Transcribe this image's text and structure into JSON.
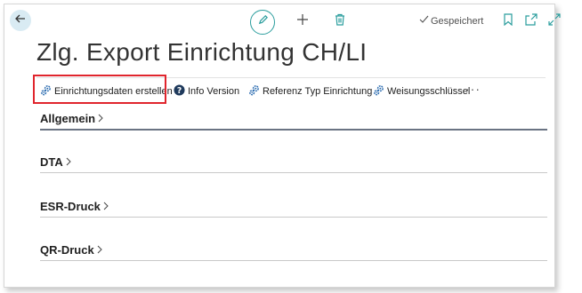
{
  "header": {
    "saved_status": "Gespeichert",
    "icons": {
      "back": "arrow-left-icon",
      "edit": "pencil-icon",
      "new": "plus-icon",
      "delete": "trash-icon",
      "saved": "checkmark-icon",
      "bookmark": "bookmark-icon",
      "open_new_window": "open-in-new-window-icon",
      "expand": "expand-diagonal-icon"
    }
  },
  "page": {
    "title": "Zlg. Export Einrichtung CH/LI"
  },
  "actions": [
    {
      "label": "Einrichtungsdaten erstellen",
      "icon": "gears-icon",
      "highlighted": true
    },
    {
      "label": "Info Version",
      "icon": "help-circle-icon",
      "highlighted": false
    },
    {
      "label": "Referenz Typ Einrichtung",
      "icon": "gears-icon",
      "highlighted": false
    },
    {
      "label": "Weisungsschlüssel",
      "icon": "gears-icon",
      "highlighted": false
    }
  ],
  "more_label": "···",
  "sections": [
    {
      "title": "Allgemein"
    },
    {
      "title": "DTA"
    },
    {
      "title": "ESR-Druck"
    },
    {
      "title": "QR-Druck"
    }
  ],
  "colors": {
    "accent": "#2a9d9d",
    "highlight_border": "#e0252d",
    "back_button_bg": "#d9ebf3",
    "gear_icon": "#2b6cb0"
  }
}
